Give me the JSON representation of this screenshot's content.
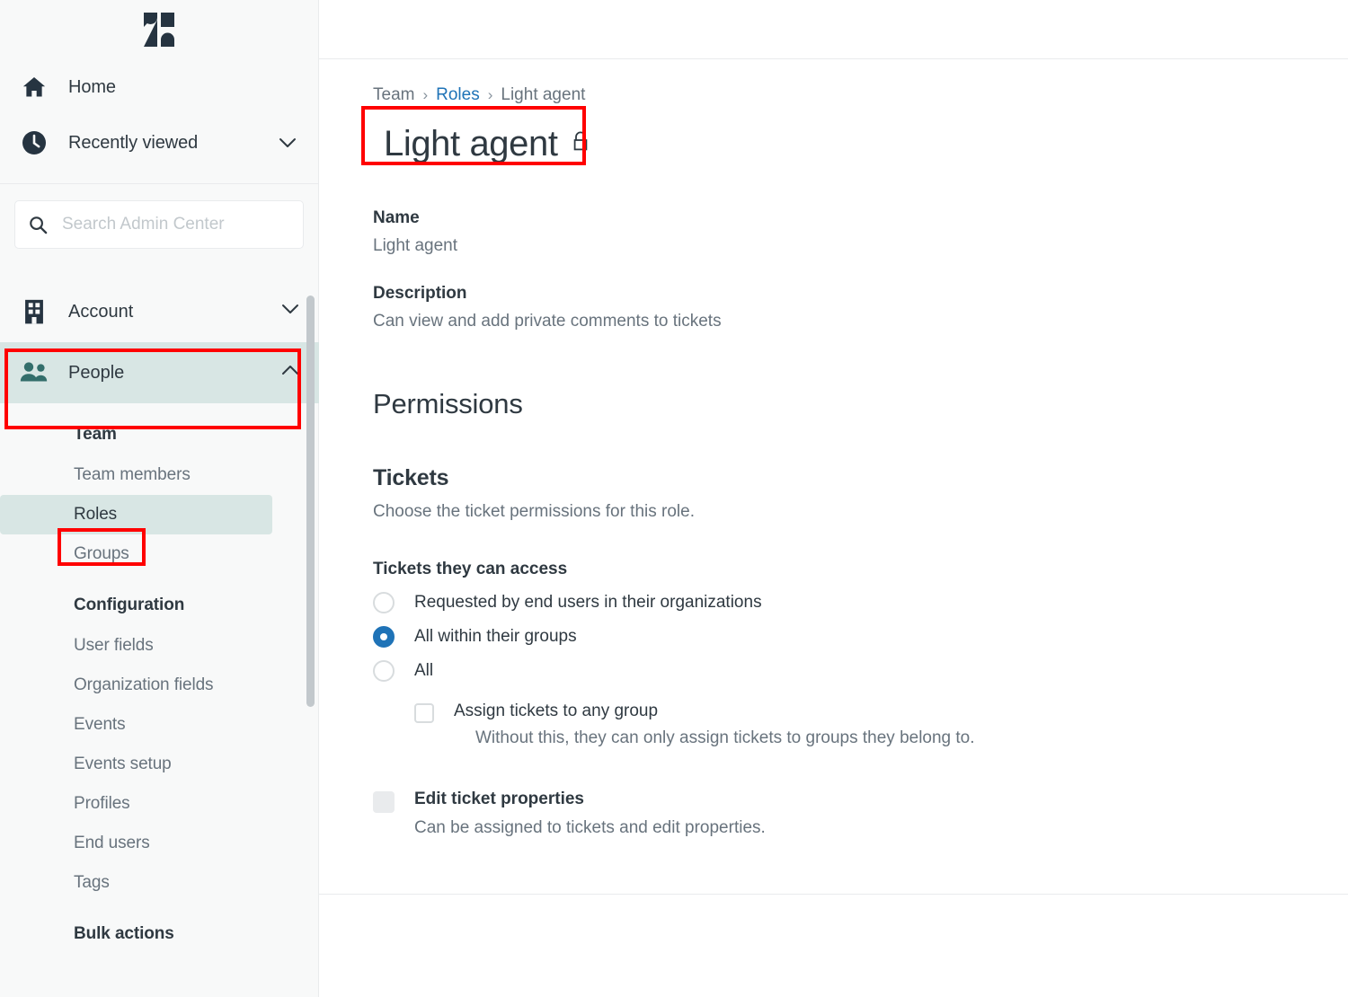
{
  "brand": {
    "logo": "zendesk-logo"
  },
  "sidebar": {
    "primary": [
      {
        "label": "Home",
        "icon": "home-icon"
      },
      {
        "label": "Recently viewed",
        "icon": "clock-icon",
        "chevron": "chevron-down-icon"
      }
    ],
    "search": {
      "placeholder": "Search Admin Center",
      "value": "",
      "icon": "search-icon"
    },
    "sections": [
      {
        "label": "Account",
        "icon": "building-icon",
        "chevron": "chevron-down-icon",
        "expanded": false
      },
      {
        "label": "People",
        "icon": "people-icon",
        "chevron": "chevron-up-icon",
        "expanded": true
      }
    ],
    "groups": [
      {
        "heading": "Team",
        "items": [
          {
            "label": "Team members",
            "selected": false
          },
          {
            "label": "Roles",
            "selected": true
          },
          {
            "label": "Groups",
            "selected": false
          }
        ]
      },
      {
        "heading": "Configuration",
        "items": [
          {
            "label": "User fields",
            "selected": false
          },
          {
            "label": "Organization fields",
            "selected": false
          },
          {
            "label": "Events",
            "selected": false
          },
          {
            "label": "Events setup",
            "selected": false
          },
          {
            "label": "Profiles",
            "selected": false
          },
          {
            "label": "End users",
            "selected": false
          },
          {
            "label": "Tags",
            "selected": false
          }
        ]
      },
      {
        "heading": "Bulk actions",
        "items": []
      }
    ]
  },
  "main": {
    "breadcrumb": {
      "first": "Team",
      "sep": "›",
      "link": "Roles",
      "current": "Light agent"
    },
    "title": "Light agent",
    "title_icon": "lock-icon",
    "name": {
      "label": "Name",
      "value": "Light agent"
    },
    "description": {
      "label": "Description",
      "value": "Can view and add private comments to tickets"
    },
    "permissions_heading": "Permissions",
    "tickets": {
      "heading": "Tickets",
      "description": "Choose the ticket permissions for this role.",
      "access_group_label": "Tickets they can access",
      "options": [
        {
          "label": "Requested by end users in their organizations",
          "checked": false
        },
        {
          "label": "All within their groups",
          "checked": true
        },
        {
          "label": "All",
          "checked": false
        }
      ],
      "assign_any_group": {
        "label": "Assign tickets to any group",
        "hint": "Without this, they can only assign tickets to groups they belong to.",
        "checked": false
      },
      "edit_ticket_properties": {
        "label": "Edit ticket properties",
        "hint": "Can be assigned to tickets and edit properties.",
        "checked": false,
        "disabled": true
      }
    }
  },
  "annotations": {
    "color": "#ff0000",
    "boxes": [
      "page-title",
      "sidebar-section-people",
      "sidebar-item-roles"
    ]
  }
}
